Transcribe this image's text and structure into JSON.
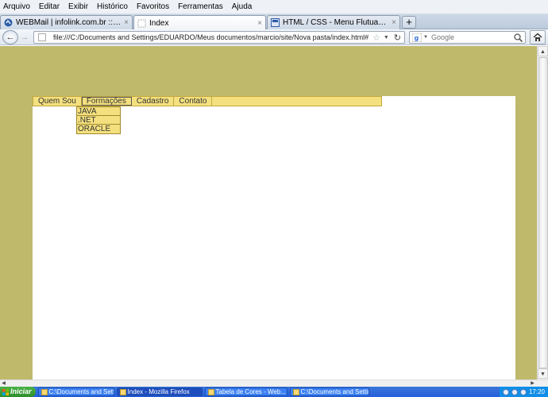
{
  "menubar": {
    "items": [
      "Arquivo",
      "Editar",
      "Exibir",
      "Histórico",
      "Favoritos",
      "Ferramentas",
      "Ajuda"
    ]
  },
  "tabs": [
    {
      "title": "WEBMail | infolink.com.br :: Caixa de Ent...",
      "close": "×"
    },
    {
      "title": "Index",
      "close": "×"
    },
    {
      "title": "HTML / CSS - Menu Flutuante",
      "close": "×"
    }
  ],
  "newtab_label": "+",
  "nav": {
    "url": "file:///C:/Documents and Settings/EDUARDO/Meus documentos/marcio/site/Nova pasta/index.html#",
    "search_placeholder": "Google"
  },
  "site": {
    "menu": [
      "Quem Sou",
      "Formações",
      "Cadastro",
      "Contato"
    ],
    "submenu": [
      "JAVA",
      ".NET",
      "ORACLE"
    ]
  },
  "taskbar": {
    "start": "Iniciar",
    "items": [
      "C:\\Documents and Settin...",
      "Index - Mozilla Firefox",
      "Tabela de Cores - Web...",
      "C:\\Documents and Settin..."
    ],
    "clock": "17:20"
  },
  "colors": {
    "page_background": "#bfb96c",
    "menu_background": "#f4e07e",
    "menu_border": "#c3a840"
  }
}
